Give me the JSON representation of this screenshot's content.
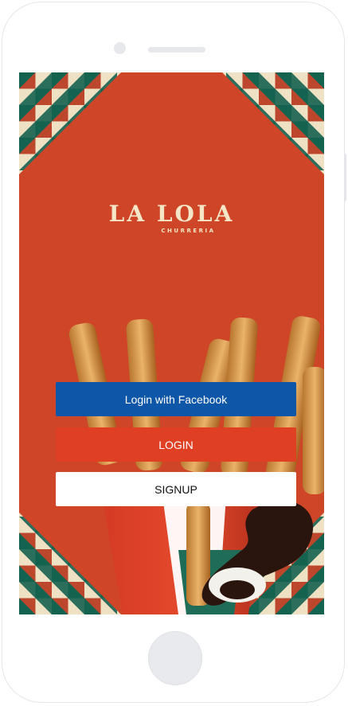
{
  "brand": {
    "name": "LA LOLA",
    "tagline": "CHURRERIA"
  },
  "buttons": {
    "facebook_label": "Login with Facebook",
    "login_label": "LOGIN",
    "signup_label": "SIGNUP"
  },
  "colors": {
    "background": "#cf4528",
    "facebook": "#0e56a8",
    "login": "#df3f22",
    "signup": "#ffffff",
    "pattern_green": "#146250",
    "pattern_cream": "#efe2c4"
  },
  "icons": [
    "decorative-tile-pattern",
    "churros-photo"
  ]
}
